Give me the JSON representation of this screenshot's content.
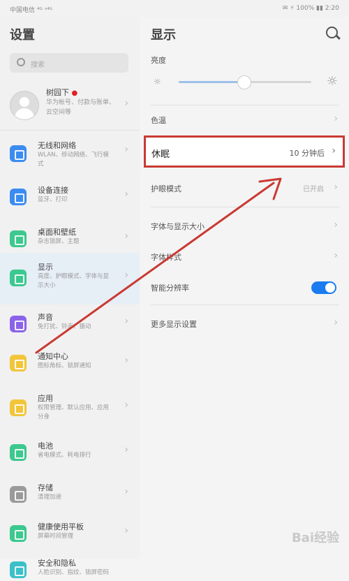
{
  "status": {
    "left": "中国电信 ⁴ᴳ ˢ⁴ᴳ",
    "right": "✉ ⚡ 100% ▮▮ 2:20"
  },
  "left": {
    "title": "设置",
    "search_placeholder": "搜索",
    "profile": {
      "name": "树园下",
      "desc": "华为帐号、付款与账单、云空间等"
    },
    "items": [
      {
        "label": "无线和网络",
        "desc": "WLAN、移动网络、飞行模式",
        "color": "#3b8cf0",
        "icon": "wifi-icon"
      },
      {
        "label": "设备连接",
        "desc": "蓝牙、打印",
        "color": "#3b8cf0",
        "icon": "device-connection-icon"
      },
      {
        "label": "桌面和壁纸",
        "desc": "杂志锁屏、主题",
        "color": "#3cc88e",
        "icon": "wallpaper-icon"
      },
      {
        "label": "显示",
        "desc": "亮度、护眼模式、字体与显示大小",
        "color": "#3cc88e",
        "icon": "display-icon"
      },
      {
        "label": "声音",
        "desc": "免打扰、铃声、振动",
        "color": "#8a64e8",
        "icon": "sound-icon"
      },
      {
        "label": "通知中心",
        "desc": "图标角标、锁屏通知",
        "color": "#f2c53a",
        "icon": "notification-icon"
      },
      {
        "label": "应用",
        "desc": "权限管理、默认应用、应用分身",
        "color": "#f2c53a",
        "icon": "apps-icon"
      },
      {
        "label": "电池",
        "desc": "省电模式、耗电排行",
        "color": "#3cc88e",
        "icon": "battery-icon"
      },
      {
        "label": "存储",
        "desc": "清理加速",
        "color": "#9a9a9a",
        "icon": "storage-icon"
      },
      {
        "label": "健康使用平板",
        "desc": "屏幕时间管理",
        "color": "#3cc88e",
        "icon": "digital-balance-icon"
      },
      {
        "label": "安全和隐私",
        "desc": "人脸识别、指纹、锁屏密码",
        "color": "#3cc0c8",
        "icon": "security-icon"
      }
    ]
  },
  "right": {
    "title": "显示",
    "brightness_label": "亮度",
    "brightness_level": 0.49,
    "rows": {
      "color": {
        "label": "色温"
      },
      "sleep": {
        "label": "休眠",
        "value": "10 分钟后"
      },
      "eye": {
        "label": "护眼模式",
        "value": "已开启"
      },
      "font": {
        "label": "字体与显示大小"
      },
      "text_style": {
        "label": "字体样式"
      },
      "smart_res": {
        "label": "智能分辨率",
        "on": true
      },
      "more": {
        "label": "更多显示设置"
      }
    }
  },
  "watermark": "Bai经验",
  "colors": {
    "accent": "#1a7cf0",
    "highlight_border": "#c93a33",
    "arrow": "#c93a33"
  }
}
